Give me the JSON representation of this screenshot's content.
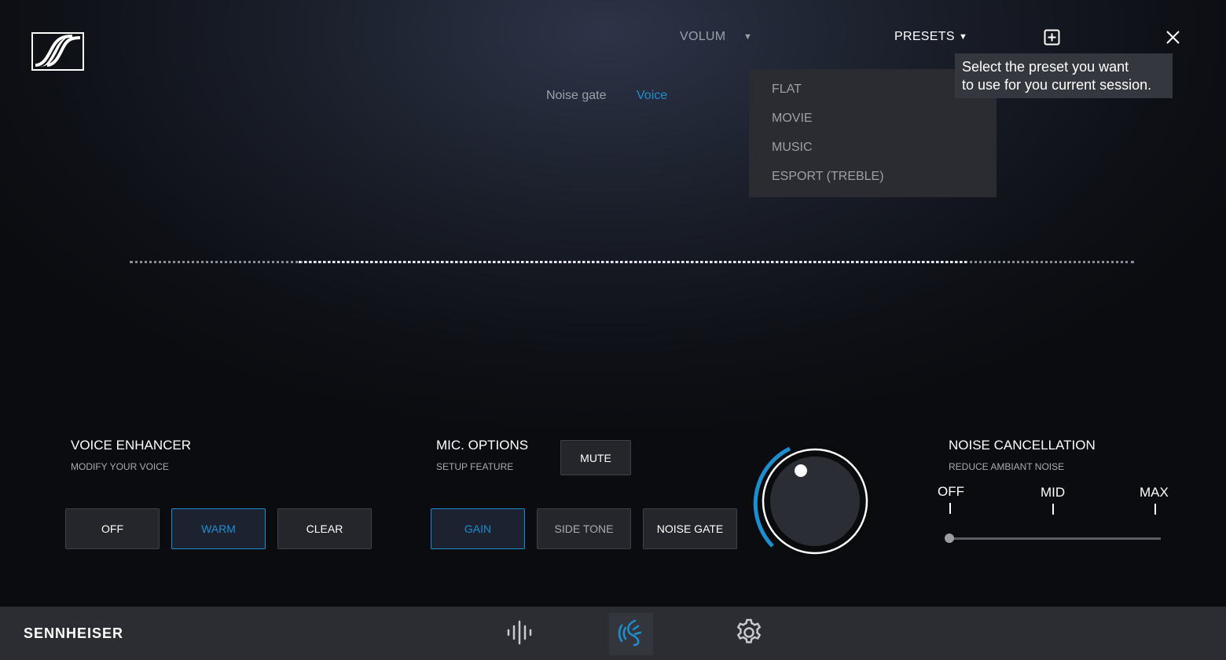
{
  "header": {
    "volume_label": "VOLUM",
    "volume_dropdown_icon": "triangle-down-icon",
    "presets_label": "PRESETS",
    "presets_dropdown_icon": "triangle-down-icon",
    "add_preset_icon": "plus-square-icon",
    "close_icon": "close-icon"
  },
  "tabs": [
    {
      "label": "Noise gate",
      "active": false
    },
    {
      "label": "Voice",
      "active": true
    }
  ],
  "presets_menu": {
    "items": [
      "FLAT",
      "MOVIE",
      "MUSIC",
      "ESPORT (TREBLE)"
    ]
  },
  "tooltip": {
    "line1": "Select the preset you want",
    "line2": "to use for you current session."
  },
  "voice_enhancer": {
    "title": "VOICE ENHANCER",
    "subtitle": "MODIFY YOUR VOICE",
    "buttons": [
      {
        "label": "OFF",
        "active": false
      },
      {
        "label": "WARM",
        "active": true
      },
      {
        "label": "CLEAR",
        "active": false
      }
    ]
  },
  "mic_options": {
    "title": "MIC. OPTIONS",
    "subtitle": "SETUP FEATURE",
    "mute_label": "MUTE",
    "buttons": [
      {
        "label": "GAIN",
        "active": true
      },
      {
        "label": "SIDE TONE",
        "active": false
      },
      {
        "label": "NOISE GATE",
        "active": false
      }
    ]
  },
  "knob": {
    "level": 0.22
  },
  "noise_cancellation": {
    "title": "NOISE CANCELLATION",
    "subtitle": "REDUCE AMBIANT NOISE",
    "levels": [
      "OFF",
      "MID",
      "MAX"
    ],
    "selected": "OFF",
    "tick_glyph": "|"
  },
  "footer": {
    "brand": "SENNHEISER",
    "nav": [
      {
        "icon": "equalizer-icon",
        "selected": false
      },
      {
        "icon": "microphone-voice-icon",
        "selected": true
      },
      {
        "icon": "gear-icon",
        "selected": false
      }
    ]
  },
  "colors": {
    "accent": "#1d8fd1",
    "footer_bg": "#2b2d33",
    "menu_bg": "#2a2c32"
  }
}
